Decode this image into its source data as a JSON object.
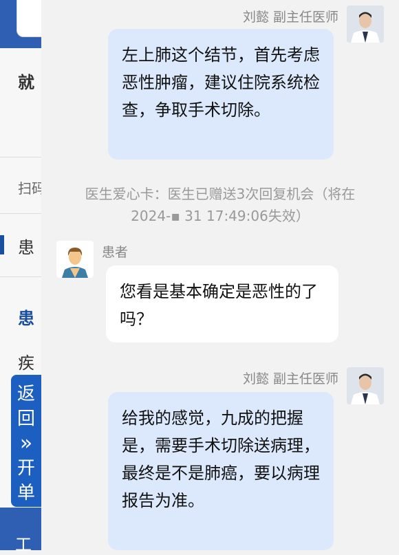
{
  "background": {
    "section_heading": "就",
    "scan_label": "扫码",
    "patient_tab": "患",
    "patient_heading": "患",
    "disease_label": "疾",
    "back_button": {
      "line1": "返",
      "line2": "回",
      "arrows": "»",
      "line3": "开",
      "line4": "单"
    },
    "bottom_label": "工"
  },
  "chat": {
    "messages": [
      {
        "sender": "刘懿 副主任医师",
        "role": "doctor",
        "text": "左上肺这个结节，首先考虑恶性肿瘤，建议住院系统检查，争取手术切除。"
      },
      {
        "role": "system",
        "text_line1": "医生爱心卡：医生已赠送3次回复机会（将在",
        "text_line2": "2024-▪ 31 17:49:06失效）"
      },
      {
        "sender": "患者",
        "role": "patient",
        "text": "您看是基本确定是恶性的了吗？"
      },
      {
        "sender": "刘懿 副主任医师",
        "role": "doctor",
        "text": "给我的感觉，九成的把握是，需要手术切除送病理，最终是不是肺癌，要以病理报告为准。"
      }
    ]
  }
}
